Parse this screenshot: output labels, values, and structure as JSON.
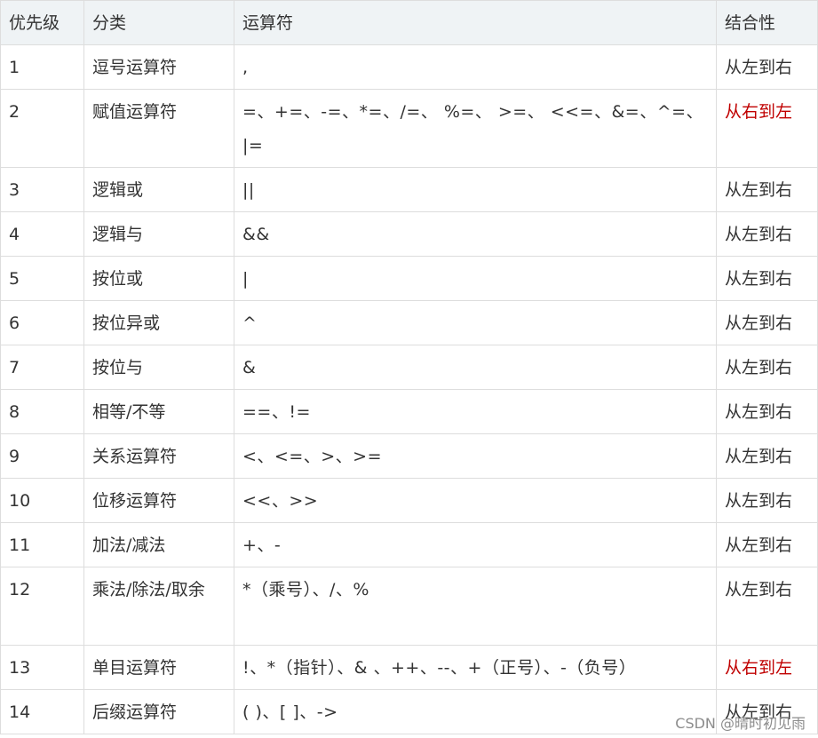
{
  "headers": {
    "priority": "优先级",
    "category": "分类",
    "operators": "运算符",
    "associativity": "结合性"
  },
  "rows": [
    {
      "priority": "1",
      "category": "逗号运算符",
      "operators": ",",
      "associativity": "从左到右"
    },
    {
      "priority": "2",
      "category": "赋值运算符",
      "operators": "=、+=、-=、*=、/=、 %=、 >=、 <<=、&=、^=、|=",
      "associativity": "从右到左"
    },
    {
      "priority": "3",
      "category": "逻辑或",
      "operators": "||",
      "associativity": "从左到右"
    },
    {
      "priority": "4",
      "category": "逻辑与",
      "operators": "&&",
      "associativity": "从左到右"
    },
    {
      "priority": "5",
      "category": "按位或",
      "operators": "|",
      "associativity": "从左到右"
    },
    {
      "priority": "6",
      "category": "按位异或",
      "operators": "^",
      "associativity": "从左到右"
    },
    {
      "priority": "7",
      "category": "按位与",
      "operators": "&",
      "associativity": "从左到右"
    },
    {
      "priority": "8",
      "category": "相等/不等",
      "operators": "==、!=",
      "associativity": "从左到右"
    },
    {
      "priority": "9",
      "category": "关系运算符",
      "operators": "<、<=、>、>=",
      "associativity": "从左到右"
    },
    {
      "priority": "10",
      "category": "位移运算符",
      "operators": "<<、>>",
      "associativity": "从左到右"
    },
    {
      "priority": "11",
      "category": "加法/减法",
      "operators": "+、-",
      "associativity": "从左到右"
    },
    {
      "priority": "12",
      "category": "乘法/除法/取余",
      "operators": "*（乘号）、/、%",
      "associativity": "从左到右"
    },
    {
      "priority": "13",
      "category": "单目运算符",
      "operators": "!、*（指针）、& 、++、--、+（正号）、-（负号）",
      "associativity": "从右到左"
    },
    {
      "priority": "14",
      "category": "后缀运算符",
      "operators": "( )、[ ]、->",
      "associativity": "从左到右"
    }
  ],
  "watermark": "CSDN @晴时初见雨",
  "colors": {
    "header_bg": "#eff3f5",
    "border": "#dddddd",
    "text": "#333333",
    "right_to_left": "#c00000"
  }
}
